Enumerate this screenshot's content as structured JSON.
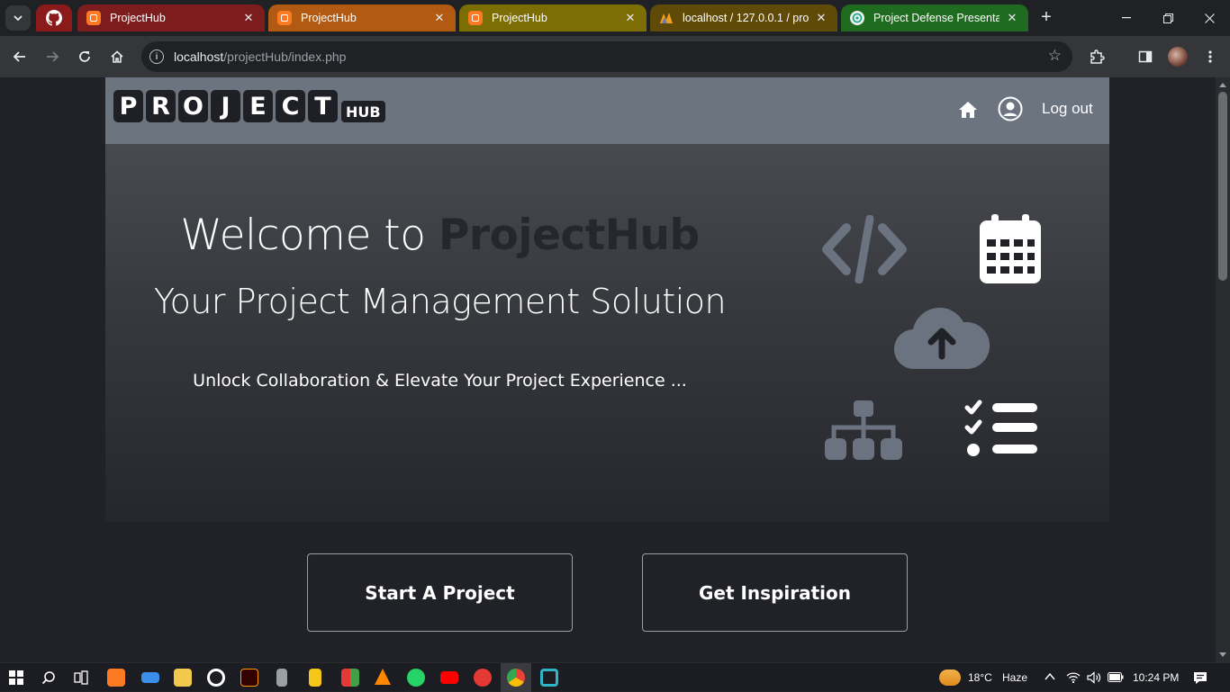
{
  "browser": {
    "tabs": [
      {
        "title": "ProjectHub",
        "active": true
      },
      {
        "title": "ProjectHub"
      },
      {
        "title": "ProjectHub"
      },
      {
        "title": "localhost / 127.0.0.1 / proj"
      },
      {
        "title": "Project Defense Presentatio"
      }
    ],
    "new_tab": "+",
    "url_host": "localhost",
    "url_path": "/projectHub/index.php"
  },
  "page": {
    "logo_letters": [
      "P",
      "R",
      "O",
      "J",
      "E",
      "C",
      "T"
    ],
    "logo_hub": "HUB",
    "nav": {
      "logout": "Log out"
    },
    "hero": {
      "title_prefix": "Welcome to ",
      "title_brand": "ProjectHub",
      "subtitle": "Your Project Management Solution",
      "tagline": "Unlock Collaboration & Elevate Your Project Experience ..."
    },
    "buttons": {
      "start": "Start A Project",
      "inspiration": "Get Inspiration"
    },
    "icon_color": "#6b7280"
  },
  "taskbar": {
    "weather_temp": "18°C",
    "weather_desc": "Haze",
    "time": "10:24 PM"
  }
}
